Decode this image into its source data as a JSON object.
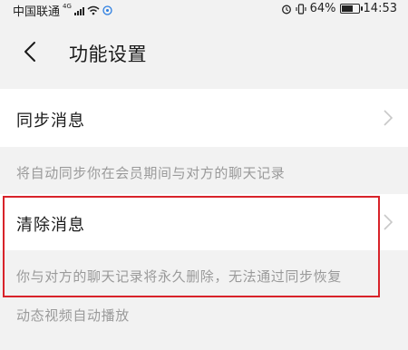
{
  "status_bar": {
    "carrier": "中国联通",
    "network": "4G",
    "battery": "64%",
    "time": "14:53",
    "icons": [
      "signal-icon",
      "wifi-icon",
      "alarm-icon",
      "vibrate-icon",
      "battery-icon"
    ]
  },
  "header": {
    "title": "功能设置",
    "back_icon": "chevron-left-icon"
  },
  "settings": {
    "sync": {
      "label": "同步消息",
      "description": "将自动同步你在会员期间与对方的聊天记录"
    },
    "clear": {
      "label": "清除消息",
      "description": "你与对方的聊天记录将永久删除，无法通过同步恢复"
    },
    "video": {
      "label": "动态视频自动播放"
    }
  },
  "colors": {
    "highlight": "#d8232a",
    "background": "#f2f2f2",
    "row_background": "#ffffff",
    "description_text": "#9a9a9a"
  }
}
